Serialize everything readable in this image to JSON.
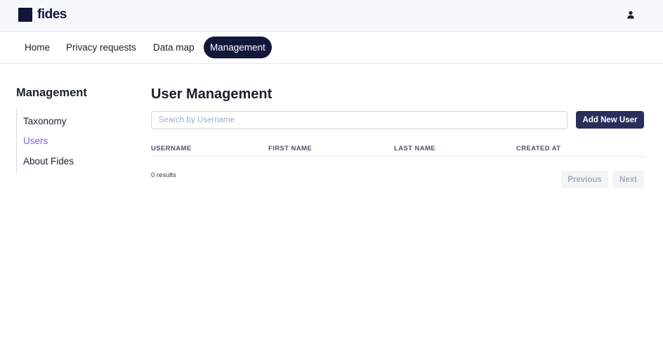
{
  "brand": {
    "name": "fides",
    "accent": "#13153a"
  },
  "header": {
    "user_icon": "user-icon"
  },
  "nav": {
    "items": [
      {
        "label": "Home",
        "active": false
      },
      {
        "label": "Privacy requests",
        "active": false
      },
      {
        "label": "Data map",
        "active": false
      },
      {
        "label": "Management",
        "active": true
      }
    ]
  },
  "sidebar": {
    "title": "Management",
    "items": [
      {
        "label": "Taxonomy",
        "active": false
      },
      {
        "label": "Users",
        "active": true
      },
      {
        "label": "About Fides",
        "active": false
      }
    ],
    "active_color": "#825be4"
  },
  "main": {
    "title": "User Management",
    "search": {
      "placeholder": "Search by Username",
      "value": ""
    },
    "add_button": "Add New User",
    "table": {
      "columns": [
        "USERNAME",
        "FIRST NAME",
        "LAST NAME",
        "CREATED AT"
      ],
      "rows": []
    },
    "results_text": "0 results",
    "pagination": {
      "previous": "Previous",
      "next": "Next"
    }
  }
}
